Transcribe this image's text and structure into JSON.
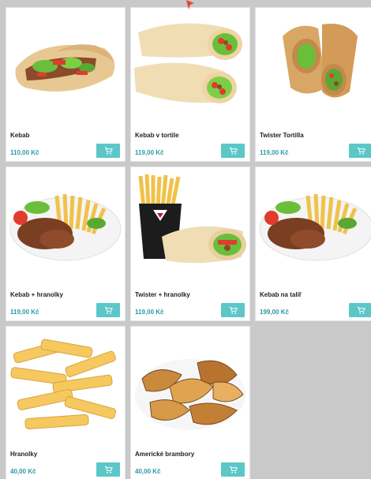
{
  "currency": "Kč",
  "products": [
    {
      "name": "Kebab",
      "price": "110,00 Kč",
      "image": "kebab-wrap-image"
    },
    {
      "name": "Kebab v tortile",
      "price": "119,00 Kč",
      "image": "kebab-tortilla-image"
    },
    {
      "name": "Twister Tortilla",
      "price": "119,00 Kč",
      "image": "twister-tortilla-image"
    },
    {
      "name": "Kebab + hranolky",
      "price": "119,00 Kč",
      "image": "kebab-fries-plate-image"
    },
    {
      "name": "Twister + hranolky",
      "price": "119,00 Kč",
      "image": "twister-fries-image"
    },
    {
      "name": "Kebab na talíř",
      "price": "199,00 Kč",
      "image": "kebab-plate-image"
    },
    {
      "name": "Hranolky",
      "price": "40,00 Kč",
      "image": "fries-image"
    },
    {
      "name": "Americké brambory",
      "price": "40,00 Kč",
      "image": "american-potatoes-image"
    }
  ],
  "icons": {
    "cart": "shopping-cart-icon",
    "cursor": "mouse-cursor-icon"
  },
  "colors": {
    "accent": "#5cc7c8",
    "price": "#2a9aa4",
    "background": "#c9c9c9"
  }
}
